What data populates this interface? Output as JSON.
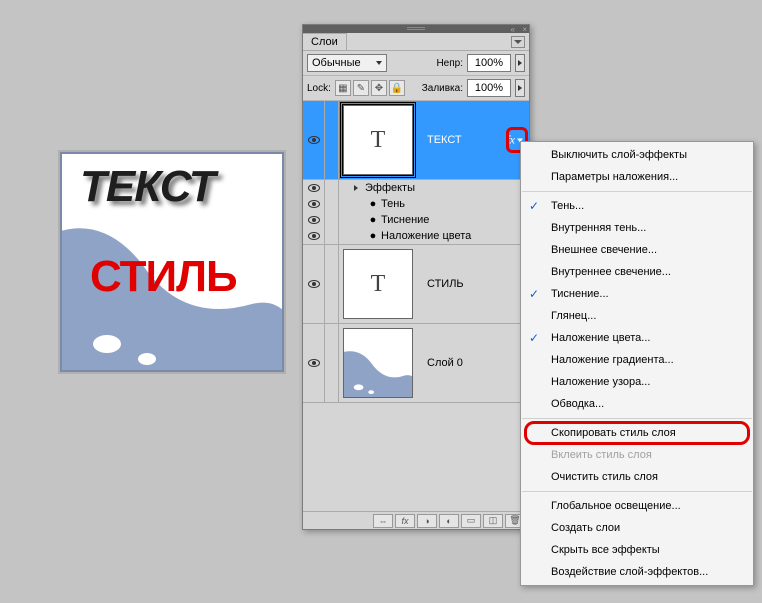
{
  "preview": {
    "text1": "ТЕКСТ",
    "text2": "СТИЛЬ"
  },
  "panel": {
    "title": "Слои",
    "blend_label": "Обычные",
    "opacity_label": "Непр:",
    "opacity_value": "100%",
    "lock_label": "Lock:",
    "fill_label": "Заливка:",
    "fill_value": "100%"
  },
  "layers": [
    {
      "name": "ТЕКСТ",
      "type": "text",
      "selected": true,
      "fx_expanded": true,
      "effects_header": "Эффекты",
      "effects": [
        "Тень",
        "Тиснение",
        "Наложение цвета"
      ]
    },
    {
      "name": "СТИЛЬ",
      "type": "text",
      "selected": false
    },
    {
      "name": "Слой 0",
      "type": "image",
      "selected": false
    }
  ],
  "context_menu": {
    "items": [
      {
        "label": "Выключить слой-эффекты",
        "type": "item"
      },
      {
        "label": "Параметры наложения...",
        "type": "item"
      },
      {
        "type": "sep"
      },
      {
        "label": "Тень...",
        "type": "item",
        "checked": true
      },
      {
        "label": "Внутренняя тень...",
        "type": "item"
      },
      {
        "label": "Внешнее свечение...",
        "type": "item"
      },
      {
        "label": "Внутреннее свечение...",
        "type": "item"
      },
      {
        "label": "Тиснение...",
        "type": "item",
        "checked": true
      },
      {
        "label": "Глянец...",
        "type": "item"
      },
      {
        "label": "Наложение цвета...",
        "type": "item",
        "checked": true
      },
      {
        "label": "Наложение градиента...",
        "type": "item"
      },
      {
        "label": "Наложение узора...",
        "type": "item"
      },
      {
        "label": "Обводка...",
        "type": "item"
      },
      {
        "type": "sep"
      },
      {
        "label": "Скопировать стиль слоя",
        "type": "item",
        "highlighted": true
      },
      {
        "label": "Вклеить стиль слоя",
        "type": "item",
        "disabled": true
      },
      {
        "label": "Очистить стиль слоя",
        "type": "item"
      },
      {
        "type": "sep"
      },
      {
        "label": "Глобальное освещение...",
        "type": "item"
      },
      {
        "label": "Создать слои",
        "type": "item"
      },
      {
        "label": "Скрыть все эффекты",
        "type": "item"
      },
      {
        "label": "Воздействие слой-эффектов...",
        "type": "item"
      }
    ]
  },
  "footer_icons": [
    "link-icon",
    "fx-icon",
    "mask-icon",
    "adjust-icon",
    "folder-icon",
    "new-icon",
    "trash-icon"
  ]
}
